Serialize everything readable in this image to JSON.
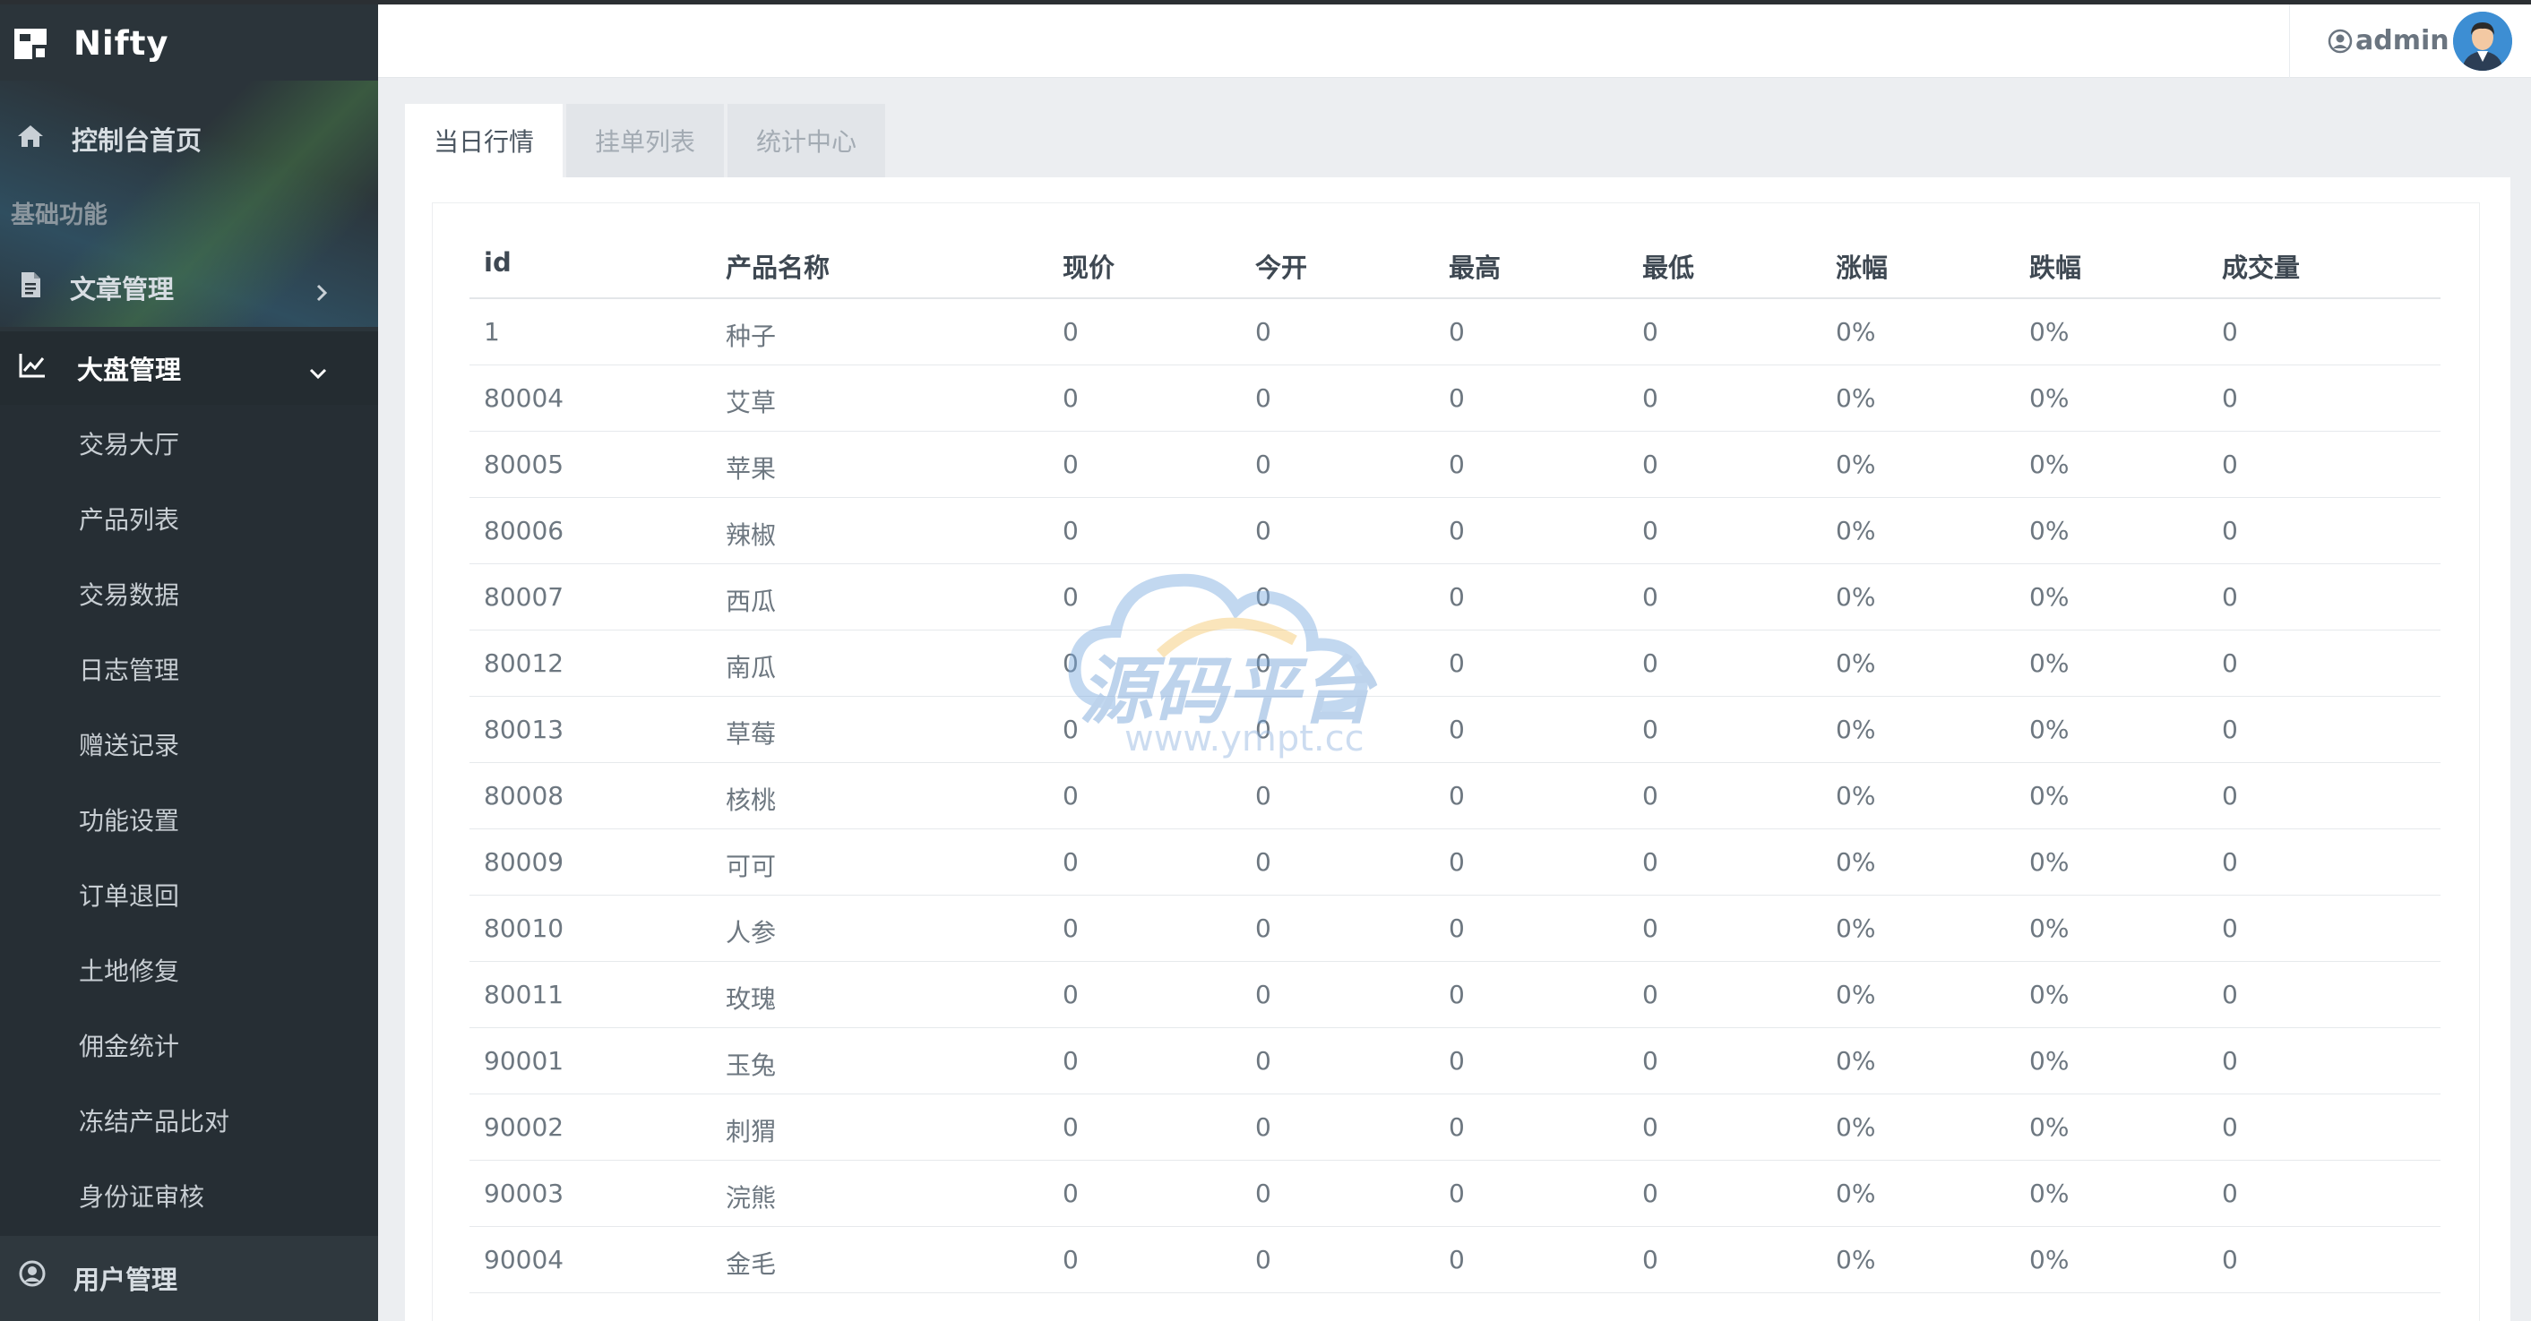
{
  "brand": {
    "name": "Nifty"
  },
  "sidebar": {
    "dashboard_label": "控制台首页",
    "section_label": "基础功能",
    "article_label": "文章管理",
    "market_label": "大盘管理",
    "submenu": [
      "交易大厅",
      "产品列表",
      "交易数据",
      "日志管理",
      "赠送记录",
      "功能设置",
      "订单退回",
      "土地修复",
      "佣金统计",
      "冻结产品比对",
      "身份证审核"
    ],
    "user_label": "用户管理"
  },
  "header": {
    "admin_name": "admin"
  },
  "tabs": [
    "当日行情",
    "挂单列表",
    "统计中心"
  ],
  "table": {
    "headers": [
      "id",
      "产品名称",
      "现价",
      "今开",
      "最高",
      "最低",
      "涨幅",
      "跌幅",
      "成交量"
    ],
    "rows": [
      [
        "1",
        "种子",
        "0",
        "0",
        "0",
        "0",
        "0%",
        "0%",
        "0"
      ],
      [
        "80004",
        "艾草",
        "0",
        "0",
        "0",
        "0",
        "0%",
        "0%",
        "0"
      ],
      [
        "80005",
        "苹果",
        "0",
        "0",
        "0",
        "0",
        "0%",
        "0%",
        "0"
      ],
      [
        "80006",
        "辣椒",
        "0",
        "0",
        "0",
        "0",
        "0%",
        "0%",
        "0"
      ],
      [
        "80007",
        "西瓜",
        "0",
        "0",
        "0",
        "0",
        "0%",
        "0%",
        "0"
      ],
      [
        "80012",
        "南瓜",
        "0",
        "0",
        "0",
        "0",
        "0%",
        "0%",
        "0"
      ],
      [
        "80013",
        "草莓",
        "0",
        "0",
        "0",
        "0",
        "0%",
        "0%",
        "0"
      ],
      [
        "80008",
        "核桃",
        "0",
        "0",
        "0",
        "0",
        "0%",
        "0%",
        "0"
      ],
      [
        "80009",
        "可可",
        "0",
        "0",
        "0",
        "0",
        "0%",
        "0%",
        "0"
      ],
      [
        "80010",
        "人参",
        "0",
        "0",
        "0",
        "0",
        "0%",
        "0%",
        "0"
      ],
      [
        "80011",
        "玫瑰",
        "0",
        "0",
        "0",
        "0",
        "0%",
        "0%",
        "0"
      ],
      [
        "90001",
        "玉兔",
        "0",
        "0",
        "0",
        "0",
        "0%",
        "0%",
        "0"
      ],
      [
        "90002",
        "刺猬",
        "0",
        "0",
        "0",
        "0",
        "0%",
        "0%",
        "0"
      ],
      [
        "90003",
        "浣熊",
        "0",
        "0",
        "0",
        "0",
        "0%",
        "0%",
        "0"
      ],
      [
        "90004",
        "金毛",
        "0",
        "0",
        "0",
        "0",
        "0%",
        "0%",
        "0"
      ]
    ]
  },
  "watermark": {
    "text": "源码平台",
    "url": "www.ympt.cc"
  }
}
